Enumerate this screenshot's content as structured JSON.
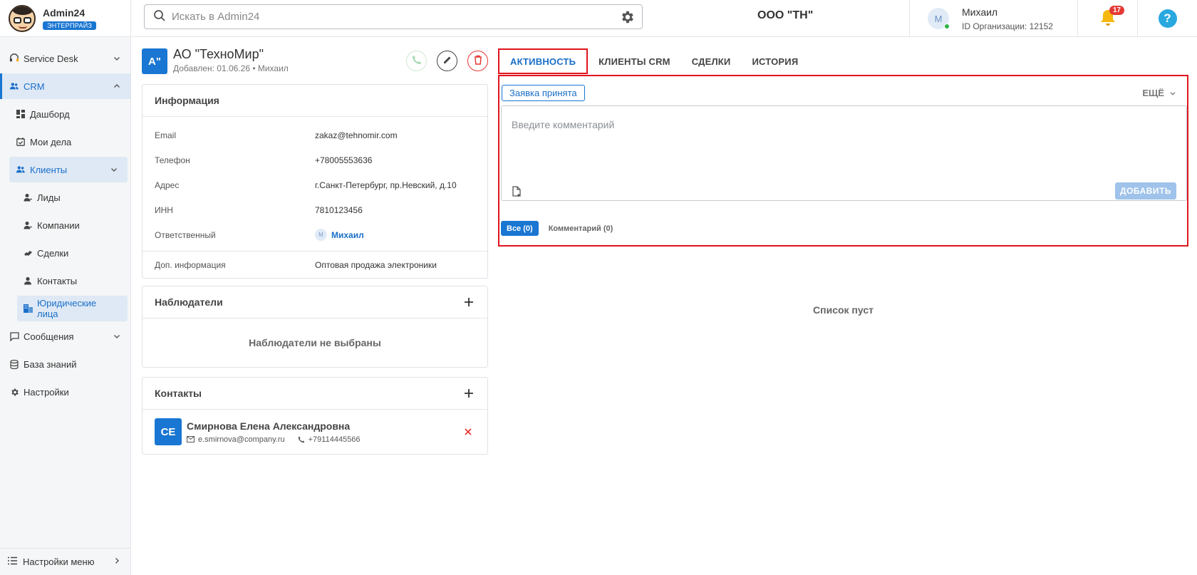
{
  "brand": {
    "name": "Admin24",
    "plan": "ЭНТЕРПРАЙЗ"
  },
  "sidebar": {
    "items": [
      {
        "label": "Service Desk"
      },
      {
        "label": "CRM"
      },
      {
        "label": "Дашборд"
      },
      {
        "label": "Мои дела"
      },
      {
        "label": "Клиенты"
      },
      {
        "label": "Лиды"
      },
      {
        "label": "Компании"
      },
      {
        "label": "Сделки"
      },
      {
        "label": "Контакты"
      },
      {
        "label": "Юридические лица"
      },
      {
        "label": "Сообщения"
      },
      {
        "label": "База знаний"
      },
      {
        "label": "Настройки"
      }
    ],
    "footer_label": "Настройки меню"
  },
  "header": {
    "search_placeholder": "Искать в Admin24",
    "org_name": "ООО \"ТН\"",
    "user": {
      "initial": "M",
      "name": "Михаил",
      "org_id": "ID Организации: 12152"
    },
    "notifications_count": "17",
    "help_label": "?"
  },
  "entity": {
    "avatar": "А\"",
    "title": "АО \"ТехноМир\"",
    "subtitle": "Добавлен: 01.06.26 • Михаил"
  },
  "info_card": {
    "title": "Информация",
    "rows": [
      {
        "key": "Email",
        "value": "zakaz@tehnomir.com"
      },
      {
        "key": "Телефон",
        "value": "+78005553636"
      },
      {
        "key": "Адрес",
        "value": "г.Санкт-Петербург, пр.Невский, д.10"
      },
      {
        "key": "ИНН",
        "value": "7810123456"
      },
      {
        "key": "Ответственный",
        "value": "Михаил",
        "avatar": "М"
      }
    ],
    "extra": {
      "key": "Доп. информация",
      "value": "Оптовая продажа электроники"
    }
  },
  "watchers_card": {
    "title": "Наблюдатели",
    "empty_text": "Наблюдатели не выбраны"
  },
  "contacts_card": {
    "title": "Контакты",
    "contacts": [
      {
        "initials": "СЕ",
        "name": "Смирнова Елена Александровна",
        "email": "e.smirnova@company.ru",
        "phone": "+79114445566"
      }
    ]
  },
  "tabs": [
    {
      "label": "АКТИВНОСТЬ"
    },
    {
      "label": "КЛИЕНТЫ CRM"
    },
    {
      "label": "СДЕЛКИ"
    },
    {
      "label": "ИСТОРИЯ"
    }
  ],
  "activity": {
    "status_chip": "Заявка принята",
    "more_label": "ЕЩЁ",
    "comment_placeholder": "Введите комментарий",
    "add_button": "ДОБАВИТЬ",
    "filters": [
      {
        "label": "Все (0)"
      },
      {
        "label": "Комментарий (0)"
      }
    ],
    "empty_text": "Список пуст"
  },
  "colors": {
    "accent": "#1976d2",
    "highlight": "#e0141e",
    "danger": "#e53935",
    "online": "#2fb344"
  }
}
